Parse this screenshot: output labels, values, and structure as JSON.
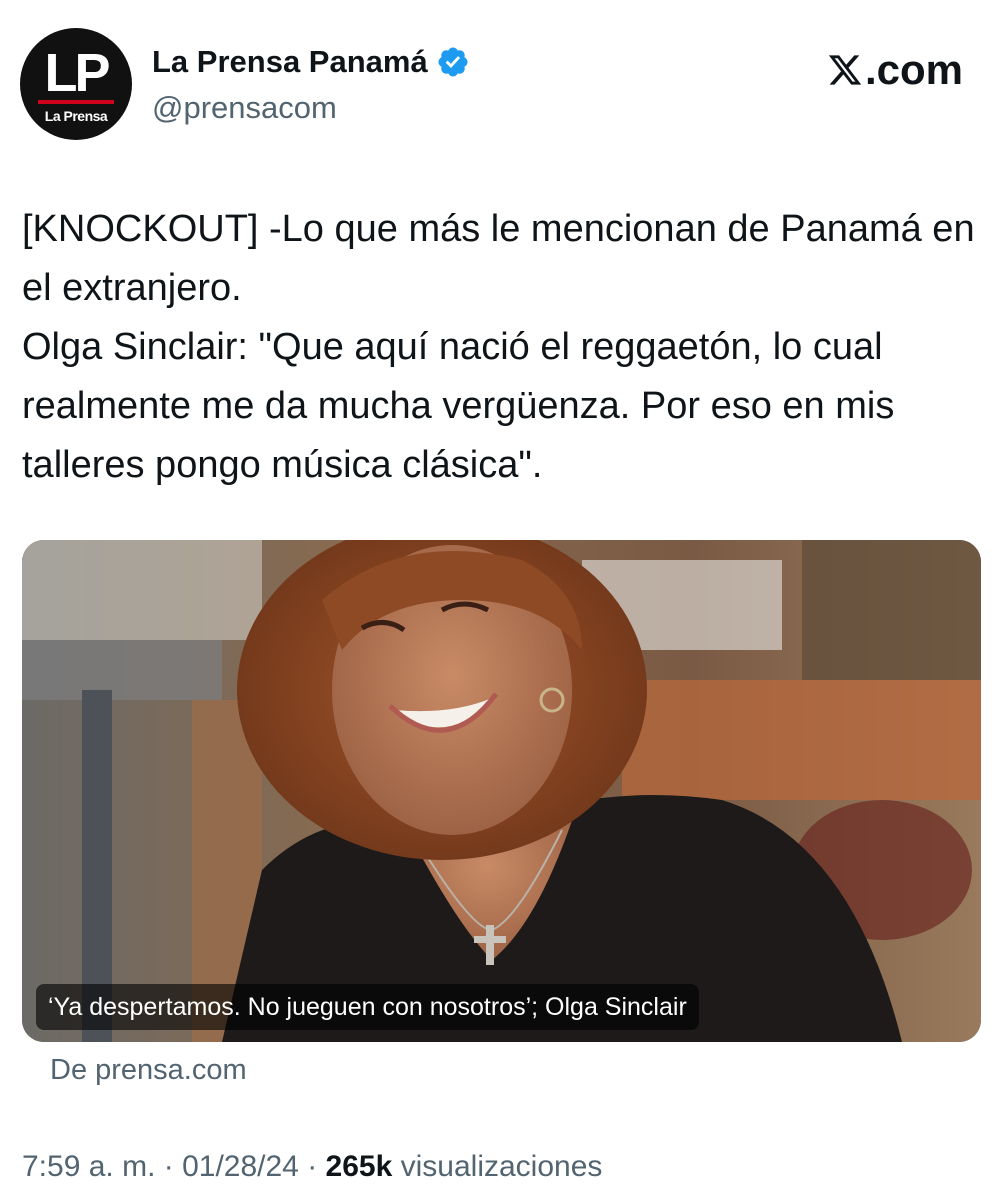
{
  "account": {
    "avatar_text": "LP",
    "avatar_subtext": "La Prensa",
    "display_name": "La Prensa Panamá",
    "verified_icon": "verified-badge-icon",
    "handle": "@prensacom"
  },
  "site_logo": {
    "icon": "x-logo-icon",
    "text": ".com"
  },
  "tweet": {
    "paragraph_1": "[KNOCKOUT] -Lo que más le mencionan de Panamá en el extranjero.",
    "paragraph_2": "Olga Sinclair: \"Que aquí nació el reggaetón, lo cual realmente me da mucha vergüenza. Por eso en mis talleres pongo música clásica\"."
  },
  "card": {
    "caption": "‘Ya despertamos. No jueguen con nosotros’; Olga Sinclair",
    "source": "De prensa.com"
  },
  "meta": {
    "time": "7:59 a. m.",
    "separator": " · ",
    "date": "01/28/24",
    "views_count": "265k",
    "views_label": " visualizaciones"
  },
  "colors": {
    "text_primary": "#0f1419",
    "text_secondary": "#536471",
    "verified_blue": "#1d9bf0",
    "brand_red": "#d0021b"
  }
}
